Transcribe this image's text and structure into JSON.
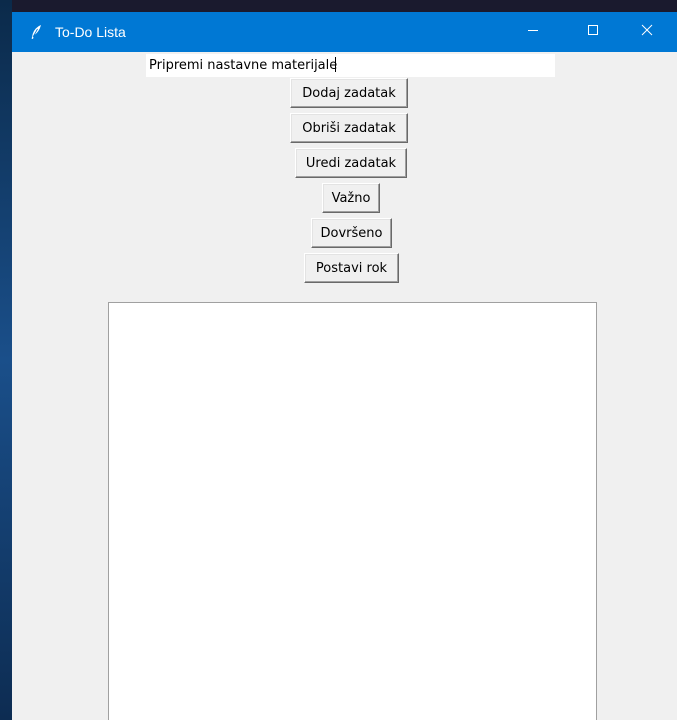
{
  "window": {
    "title": "To-Do Lista",
    "icons": {
      "app": "feather-icon",
      "minimize": "minimize-icon",
      "maximize": "maximize-icon",
      "close": "close-icon"
    },
    "colors": {
      "titlebar": "#0078d4",
      "client": "#f0f0f0"
    }
  },
  "entry": {
    "value": "Pripremi nastavne materijale"
  },
  "buttons": {
    "add": "Dodaj zadatak",
    "delete": "Obriši zadatak",
    "edit": "Uredi zadatak",
    "important": "Važno",
    "done": "Dovršeno",
    "deadline": "Postavi rok"
  },
  "task_list": {
    "items": []
  }
}
